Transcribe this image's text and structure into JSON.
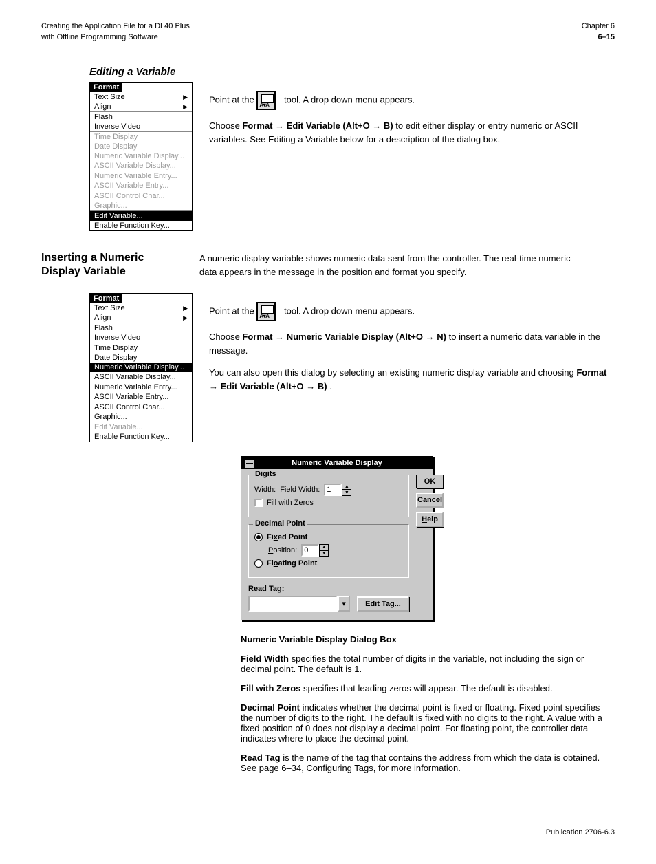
{
  "header": {
    "left_line1": "Creating the Application File for a DL40 Plus",
    "left_line2": "with Offline Programming Software",
    "right_line1": "Chapter 6",
    "page_number": "6–15"
  },
  "rowA": {
    "point_text_pre": "Point at the ",
    "point_text_post": " tool. A drop down menu appears.",
    "choose_prefix": "Choose ",
    "choose_formula": "Format → Edit Variable (Alt+O → B)",
    "choose_suffix": " to edit either display or entry numeric or ASCII variables. See Editing a Variable below for a description of the dialog box."
  },
  "menuA": {
    "title": "Format",
    "groups": [
      {
        "items": [
          {
            "label": "Text Size",
            "arrow": true
          },
          {
            "label": "Align",
            "arrow": true
          }
        ]
      },
      {
        "items": [
          {
            "label": "Flash"
          },
          {
            "label": "Inverse Video"
          }
        ]
      },
      {
        "items": [
          {
            "label": "Time Display",
            "disabled": true
          },
          {
            "label": "Date Display",
            "disabled": true
          },
          {
            "label": "Numeric Variable Display...",
            "disabled": true
          },
          {
            "label": "ASCII Variable Display...",
            "disabled": true
          }
        ]
      },
      {
        "items": [
          {
            "label": "Numeric Variable Entry...",
            "disabled": true
          },
          {
            "label": "ASCII Variable Entry...",
            "disabled": true
          }
        ]
      },
      {
        "items": [
          {
            "label": "ASCII Control Char...",
            "disabled": true
          },
          {
            "label": "Graphic...",
            "disabled": true
          }
        ]
      },
      {
        "items": [
          {
            "label": "Edit Variable...",
            "selected": true
          },
          {
            "label": "Enable Function Key..."
          }
        ]
      }
    ]
  },
  "sideA": {
    "label1": "Inserting a Numeric",
    "label2": "Display Variable"
  },
  "bodyA": "A numeric display variable shows numeric data sent from the controller. The real-time numeric data appears in the message in the position and format you specify.",
  "rowB": {
    "point_text_pre": "Point at the ",
    "point_text_post": " tool. A drop down menu appears.",
    "choose_prefix": "Choose ",
    "choose_formula": "Format → Numeric Variable Display (Alt+O → N)",
    "choose_suffix": " to insert a numeric data variable in the message.",
    "third": "You can also open this dialog by selecting an existing numeric display variable and choosing ",
    "third_formula": "Format → Edit Variable (Alt+O → B)",
    "third_suffix": "."
  },
  "menuB": {
    "title": "Format",
    "groups": [
      {
        "items": [
          {
            "label": "Text Size",
            "arrow": true
          },
          {
            "label": "Align",
            "arrow": true
          }
        ]
      },
      {
        "items": [
          {
            "label": "Flash"
          },
          {
            "label": "Inverse Video"
          }
        ]
      },
      {
        "items": [
          {
            "label": "Time Display"
          },
          {
            "label": "Date Display"
          },
          {
            "label": "Numeric Variable Display...",
            "selected": true
          },
          {
            "label": "ASCII Variable Display..."
          }
        ]
      },
      {
        "items": [
          {
            "label": "Numeric Variable Entry..."
          },
          {
            "label": "ASCII Variable Entry..."
          }
        ]
      },
      {
        "items": [
          {
            "label": "ASCII Control Char..."
          },
          {
            "label": "Graphic..."
          }
        ]
      },
      {
        "items": [
          {
            "label": "Edit Variable...",
            "disabled": true
          },
          {
            "label": "Enable Function Key..."
          }
        ]
      }
    ]
  },
  "dialog": {
    "title": "Numeric Variable Display",
    "digits_group": "Digits",
    "field_width_label": "Field Width:",
    "field_width_value": "1",
    "fill_zeros_label": "Fill with Zeros",
    "decimal_group": "Decimal Point",
    "fixed_point": "Fixed Point",
    "position_label": "Position:",
    "position_value": "0",
    "floating_point": "Floating Point",
    "read_tag_label": "Read Tag:",
    "read_tag_value": "",
    "ok": "OK",
    "cancel": "Cancel",
    "help": "Help",
    "edit_tag": "Edit Tag..."
  },
  "fields": {
    "heading": "Numeric Variable Display Dialog Box",
    "field_width": {
      "label": "Field Width",
      "desc": "specifies the total number of digits in the variable, not including the sign or decimal point. The default is 1."
    },
    "fill_zeros": {
      "label": "Fill with Zeros",
      "desc": "specifies that leading zeros will appear. The default is disabled."
    },
    "decimal": {
      "label": "Decimal Point",
      "desc": "indicates whether the decimal point is fixed or floating. Fixed point specifies the number of digits to the right. The default is fixed with no digits to the right. A value with a fixed position of 0 does not display a decimal point. For floating point, the controller data indicates where to place the decimal point."
    },
    "read_tag": {
      "label": "Read Tag",
      "desc": "is the name of the tag that contains the address from which the data is obtained. See page 6–34, Configuring Tags, for more information."
    }
  },
  "footer": "Publication 2706-6.3"
}
